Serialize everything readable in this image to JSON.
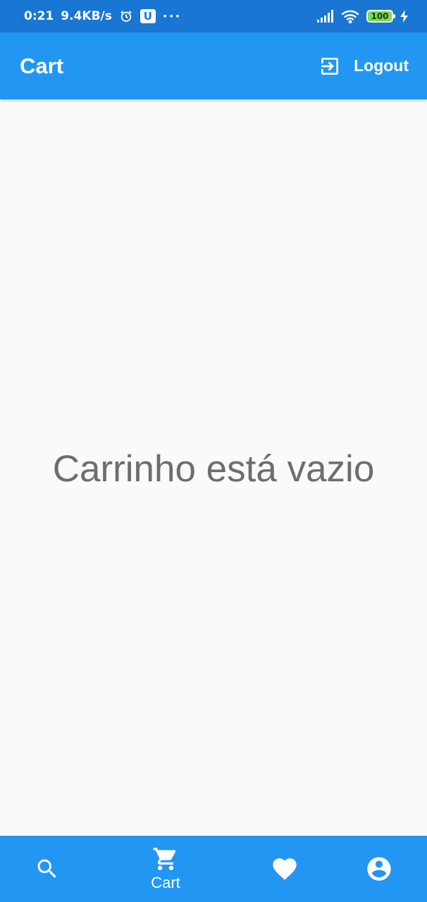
{
  "status_bar": {
    "time": "0:21",
    "network_speed": "9.4KB/s",
    "u_badge": "U",
    "more": "···",
    "battery_level": "100",
    "icons": [
      "alarm-icon",
      "signal-icon",
      "wifi-icon",
      "battery-icon",
      "charging-icon"
    ]
  },
  "app_bar": {
    "title": "Cart",
    "logout_label": "Logout",
    "logout_icon": "logout-icon",
    "color": "#2196f3"
  },
  "main": {
    "empty_message": "Carrinho está vazio"
  },
  "bottom_nav": {
    "items": [
      {
        "icon": "search-icon",
        "label": ""
      },
      {
        "icon": "cart-icon",
        "label": "Cart",
        "selected": true
      },
      {
        "icon": "heart-icon",
        "label": ""
      },
      {
        "icon": "account-icon",
        "label": ""
      }
    ],
    "color": "#2196f3"
  }
}
